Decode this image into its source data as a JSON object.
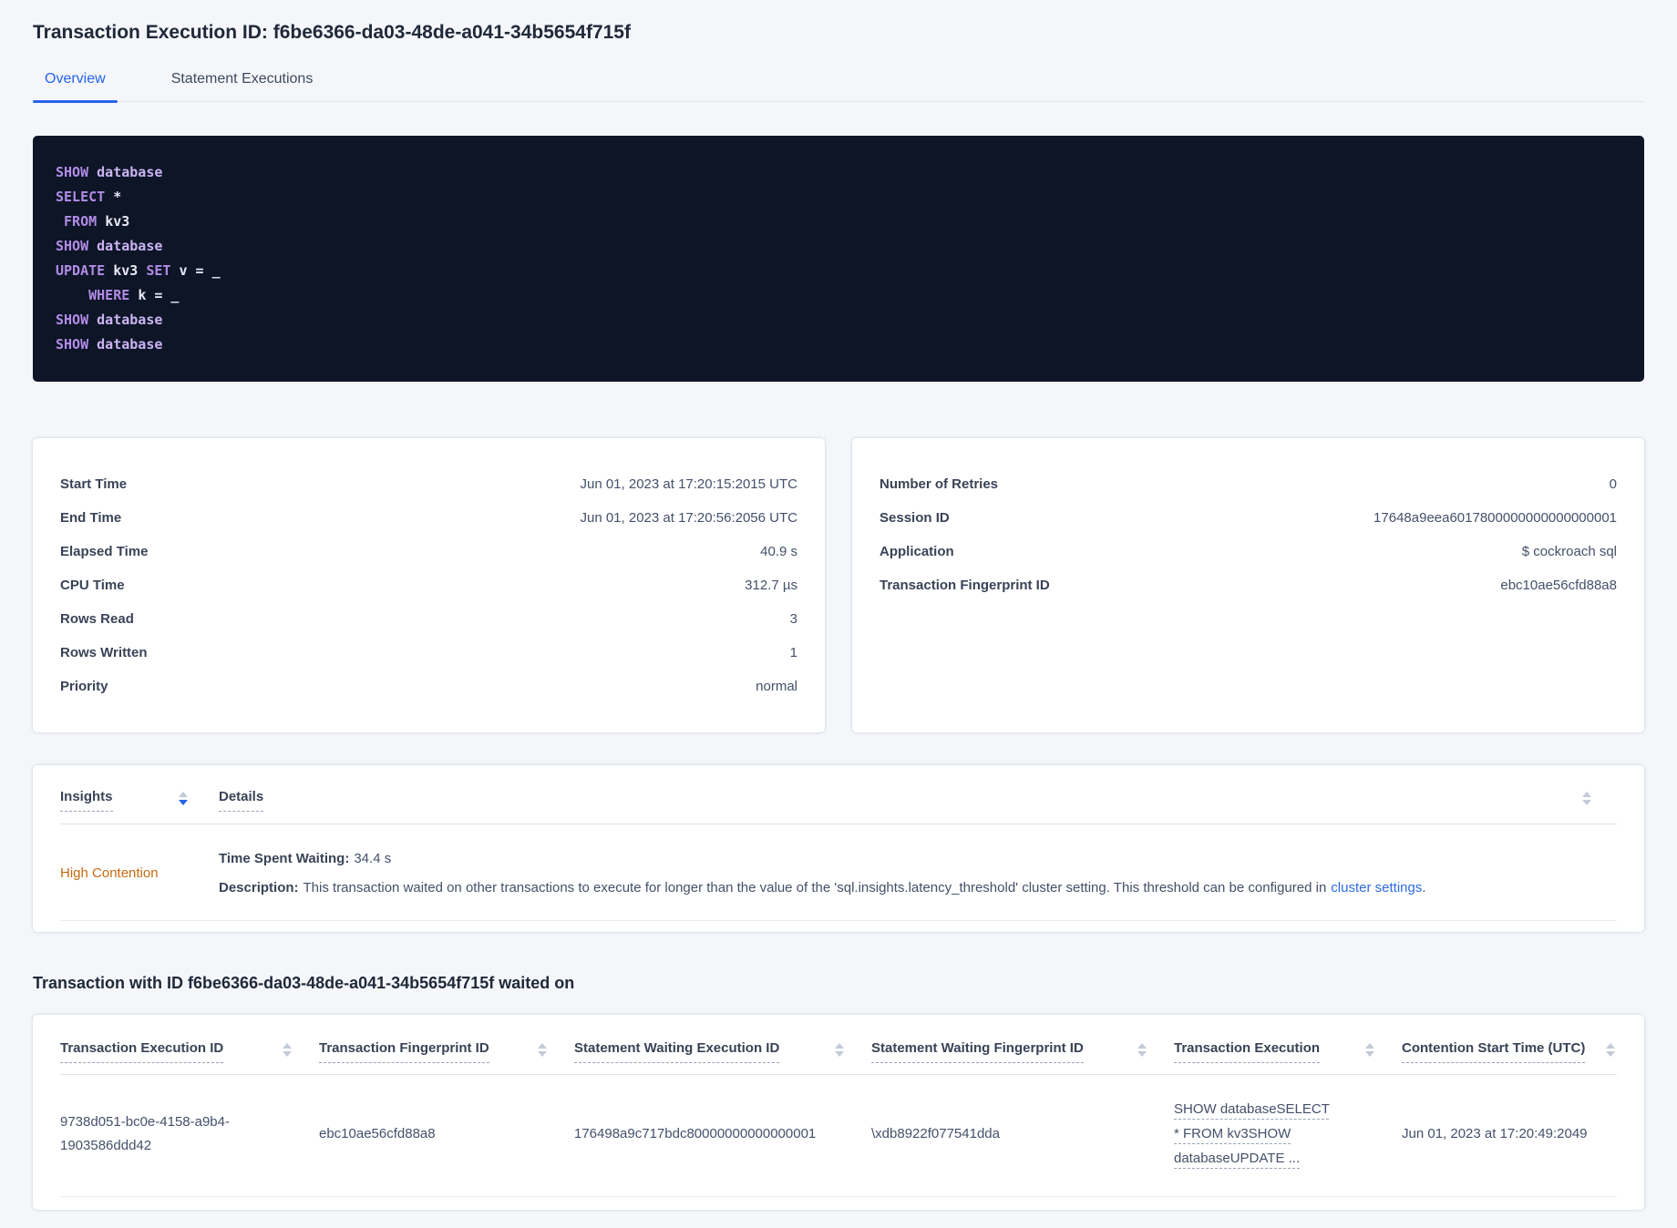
{
  "page": {
    "title": "Transaction Execution ID: f6be6366-da03-48de-a041-34b5654f715f"
  },
  "tabs": {
    "overview": "Overview",
    "statement_executions": "Statement Executions"
  },
  "sql": {
    "show_kw": "SHOW ",
    "database_id": "database",
    "select_kw": "SELECT ",
    "select_rest": "*",
    "from_kw": " FROM ",
    "from_target": "kv3",
    "update_kw": "UPDATE ",
    "update_target": "kv3 ",
    "set_kw": "SET ",
    "set_expr": "v = _",
    "where_kw": "    WHERE ",
    "where_expr": "k = _"
  },
  "execution_summary": {
    "rows": [
      {
        "label": "Start Time",
        "value": "Jun 01, 2023 at 17:20:15:2015 UTC"
      },
      {
        "label": "End Time",
        "value": "Jun 01, 2023 at 17:20:56:2056 UTC"
      },
      {
        "label": "Elapsed Time",
        "value": "40.9 s"
      },
      {
        "label": "CPU Time",
        "value": "312.7 µs"
      },
      {
        "label": "Rows Read",
        "value": "3"
      },
      {
        "label": "Rows Written",
        "value": "1"
      },
      {
        "label": "Priority",
        "value": "normal"
      }
    ]
  },
  "session_summary": {
    "rows": [
      {
        "label": "Number of Retries",
        "value": "0"
      },
      {
        "label": "Session ID",
        "value": "17648a9eea6017800000000000000001"
      },
      {
        "label": "Application",
        "value": "$ cockroach sql"
      },
      {
        "label": "Transaction Fingerprint ID",
        "value": "ebc10ae56cfd88a8"
      }
    ]
  },
  "insights": {
    "col_insights": "Insights",
    "col_details": "Details",
    "row": {
      "insight": "High Contention",
      "waiting_label": "Time Spent Waiting:",
      "waiting_value": "34.4 s",
      "description_label": "Description:",
      "description_text": "This transaction waited on other transactions to execute for longer than the value of the 'sql.insights.latency_threshold' cluster setting. This threshold can be configured in",
      "description_link": "cluster settings",
      "description_suffix": "."
    }
  },
  "waited_section": {
    "heading": "Transaction with ID f6be6366-da03-48de-a041-34b5654f715f waited on",
    "columns": [
      "Transaction Execution ID",
      "Transaction Fingerprint ID",
      "Statement Waiting Execution ID",
      "Statement Waiting Fingerprint ID",
      "Transaction Execution",
      "Contention Start Time (UTC)"
    ],
    "row": {
      "transaction_execution_id": "9738d051-bc0e-4158-a9b4-1903586ddd42",
      "transaction_fingerprint_id": "ebc10ae56cfd88a8",
      "statement_waiting_execution_id": "176498a9c717bdc80000000000000001",
      "statement_waiting_fingerprint_id": "\\xdb8922f077541dda",
      "transaction_execution": "SHOW databaseSELECT * FROM kv3SHOW databaseUPDATE ...",
      "contention_start_time": "Jun 01, 2023 at 17:20:49:2049"
    }
  },
  "colors": {
    "accent_blue": "#2563eb",
    "link_blue": "#2e6ce4",
    "insight_warning_orange": "#c7690e",
    "code_background": "#0d1527",
    "code_keyword_purple": "#b28ce6"
  }
}
